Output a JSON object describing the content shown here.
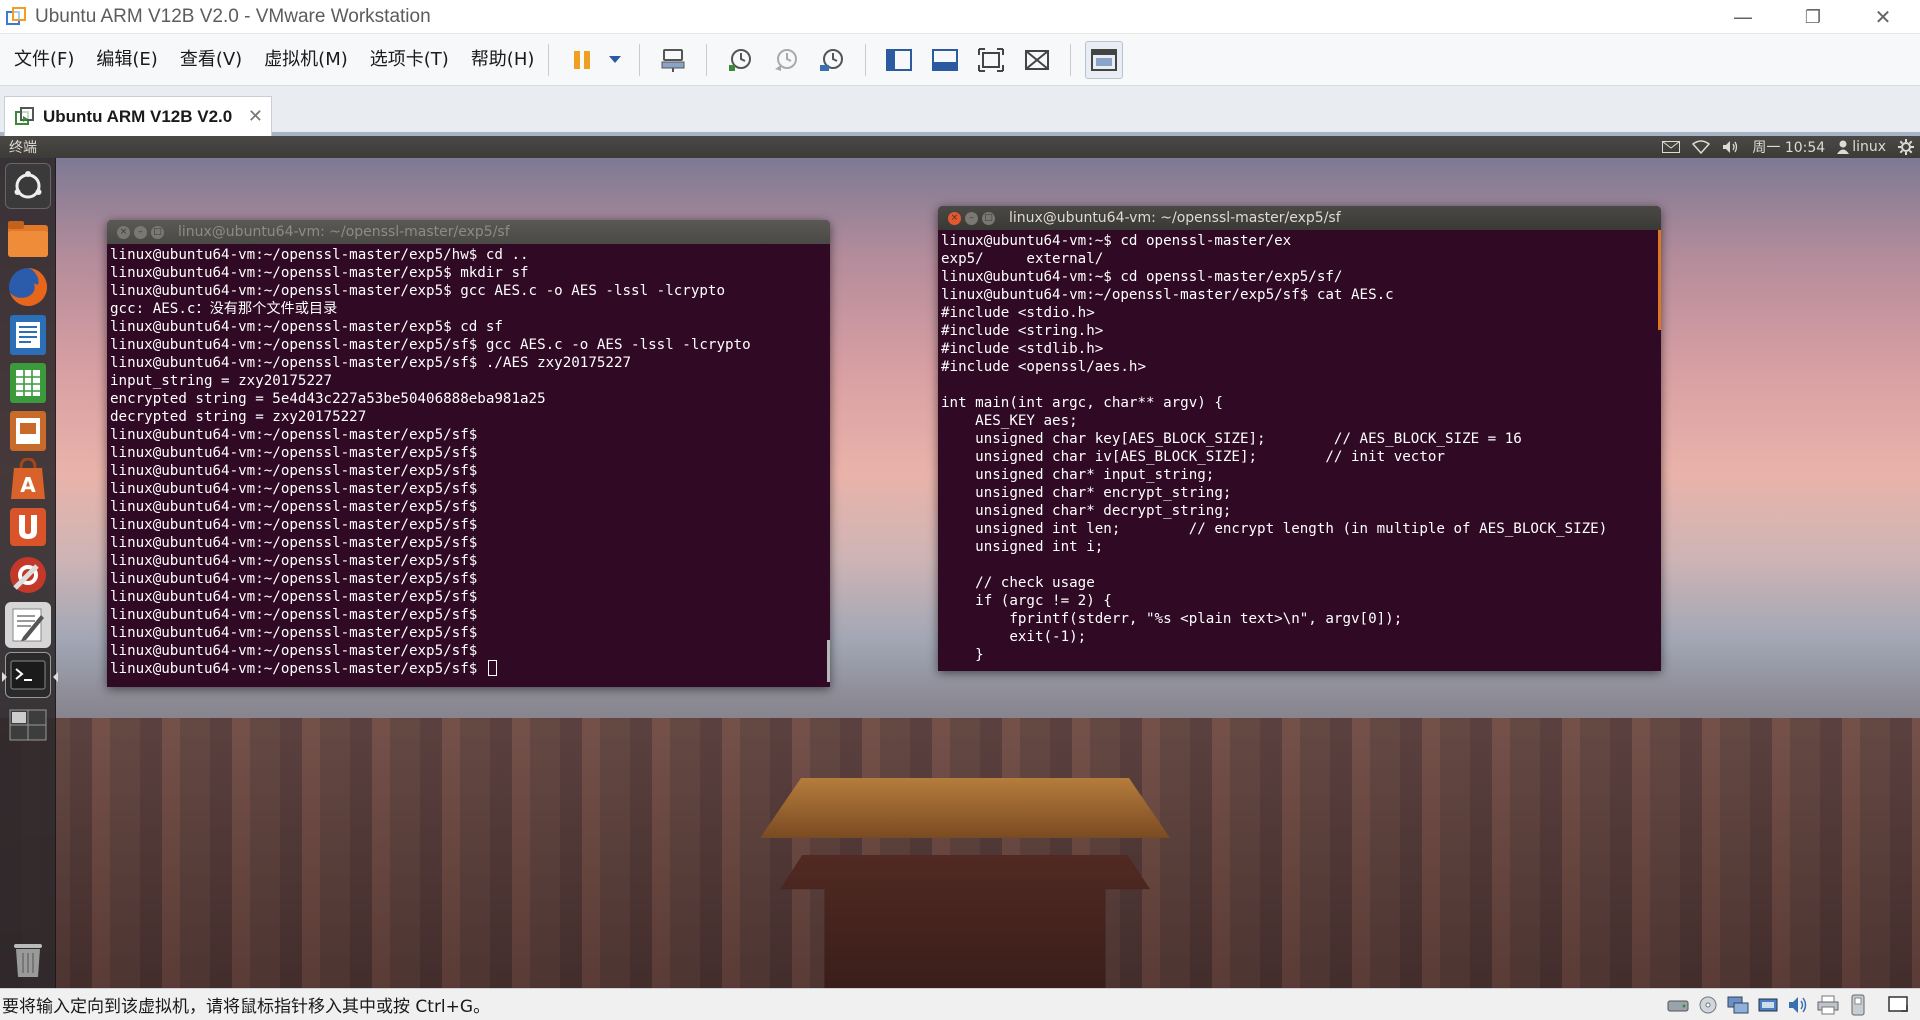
{
  "window": {
    "title": "Ubuntu ARM V12B V2.0 - VMware Workstation",
    "controls": {
      "minimize": "—",
      "restore": "❐",
      "close": "✕"
    }
  },
  "menu": [
    {
      "label": "文件(F)"
    },
    {
      "label": "编辑(E)"
    },
    {
      "label": "查看(V)"
    },
    {
      "label": "虚拟机(M)"
    },
    {
      "label": "选项卡(T)"
    },
    {
      "label": "帮助(H)"
    }
  ],
  "toolbar": {
    "icons": [
      "pause-icon",
      "dropdown-arrow-icon",
      "send-ctrl-alt-del-icon",
      "snapshot-take-icon",
      "snapshot-revert-icon",
      "snapshot-manager-icon",
      "library-icon",
      "console-view-icon",
      "full-screen-icon",
      "unity-icon",
      "thumbnail-view-icon"
    ]
  },
  "tab": {
    "label": "Ubuntu ARM V12B V2.0",
    "close": "✕"
  },
  "ubuntu_panel": {
    "app_name": "终端",
    "clock": "周一 10:54",
    "user": "linux"
  },
  "launcher": [
    {
      "name": "dash-home",
      "color": "#c9c9c9"
    },
    {
      "name": "files",
      "color": "#e0792b"
    },
    {
      "name": "firefox",
      "color": "#d96a1f"
    },
    {
      "name": "libreoffice-writer",
      "color": "#2a6fb7"
    },
    {
      "name": "libreoffice-calc",
      "color": "#3a9a3c"
    },
    {
      "name": "libreoffice-impress",
      "color": "#c86a2a"
    },
    {
      "name": "software-center",
      "color": "#d9622a"
    },
    {
      "name": "ubuntu-one",
      "color": "#d9532b"
    },
    {
      "name": "system-settings",
      "color": "#c4382a"
    },
    {
      "name": "text-editor",
      "color": "#d6d6d6"
    },
    {
      "name": "terminal",
      "color": "#2a2a2a"
    },
    {
      "name": "workspace-switcher",
      "color": "#5a5a5a"
    },
    {
      "name": "trash",
      "color": "#9a9a9a"
    }
  ],
  "terminal_left": {
    "title": "linux@ubuntu64-vm: ~/openssl-master/exp5/sf",
    "lines": [
      "linux@ubuntu64-vm:~/openssl-master/exp5/hw$ cd ..",
      "linux@ubuntu64-vm:~/openssl-master/exp5$ mkdir sf",
      "linux@ubuntu64-vm:~/openssl-master/exp5$ gcc AES.c -o AES -lssl -lcrypto",
      "gcc: AES.c：没有那个文件或目录",
      "linux@ubuntu64-vm:~/openssl-master/exp5$ cd sf",
      "linux@ubuntu64-vm:~/openssl-master/exp5/sf$ gcc AES.c -o AES -lssl -lcrypto",
      "linux@ubuntu64-vm:~/openssl-master/exp5/sf$ ./AES zxy20175227",
      "input_string = zxy20175227",
      "encrypted string = 5e4d43c227a53be50406888eba981a25",
      "decrypted string = zxy20175227",
      "linux@ubuntu64-vm:~/openssl-master/exp5/sf$",
      "linux@ubuntu64-vm:~/openssl-master/exp5/sf$",
      "linux@ubuntu64-vm:~/openssl-master/exp5/sf$",
      "linux@ubuntu64-vm:~/openssl-master/exp5/sf$",
      "linux@ubuntu64-vm:~/openssl-master/exp5/sf$",
      "linux@ubuntu64-vm:~/openssl-master/exp5/sf$",
      "linux@ubuntu64-vm:~/openssl-master/exp5/sf$",
      "linux@ubuntu64-vm:~/openssl-master/exp5/sf$",
      "linux@ubuntu64-vm:~/openssl-master/exp5/sf$",
      "linux@ubuntu64-vm:~/openssl-master/exp5/sf$",
      "linux@ubuntu64-vm:~/openssl-master/exp5/sf$",
      "linux@ubuntu64-vm:~/openssl-master/exp5/sf$",
      "linux@ubuntu64-vm:~/openssl-master/exp5/sf$"
    ],
    "prompt": "linux@ubuntu64-vm:~/openssl-master/exp5/sf$ "
  },
  "terminal_right": {
    "title": "linux@ubuntu64-vm: ~/openssl-master/exp5/sf",
    "lines": [
      "linux@ubuntu64-vm:~$ cd openssl-master/ex",
      "exp5/     external/",
      "linux@ubuntu64-vm:~$ cd openssl-master/exp5/sf/",
      "linux@ubuntu64-vm:~/openssl-master/exp5/sf$ cat AES.c",
      "#include <stdio.h>",
      "#include <string.h>",
      "#include <stdlib.h>",
      "#include <openssl/aes.h>",
      "",
      "int main(int argc, char** argv) {",
      "    AES_KEY aes;",
      "    unsigned char key[AES_BLOCK_SIZE];        // AES_BLOCK_SIZE = 16",
      "    unsigned char iv[AES_BLOCK_SIZE];        // init vector",
      "    unsigned char* input_string;",
      "    unsigned char* encrypt_string;",
      "    unsigned char* decrypt_string;",
      "    unsigned int len;        // encrypt length (in multiple of AES_BLOCK_SIZE)",
      "    unsigned int i;",
      "",
      "    // check usage",
      "    if (argc != 2) {",
      "        fprintf(stderr, \"%s <plain text>\\n\", argv[0]);",
      "        exit(-1);",
      "    }"
    ]
  },
  "statusbar": {
    "message": "要将输入定向到该虚拟机，请将鼠标指针移入其中或按 Ctrl+G。",
    "icons": [
      "hard-disk-icon",
      "cd-drive-icon",
      "network-adapter-icon",
      "usb-controller-icon",
      "sound-card-icon",
      "printer-icon",
      "display-icon",
      "message-log-icon"
    ]
  },
  "colors": {
    "terminal_bg": "#300a24",
    "close_button": "#e5572e",
    "scrollbar": "#e0761f"
  }
}
